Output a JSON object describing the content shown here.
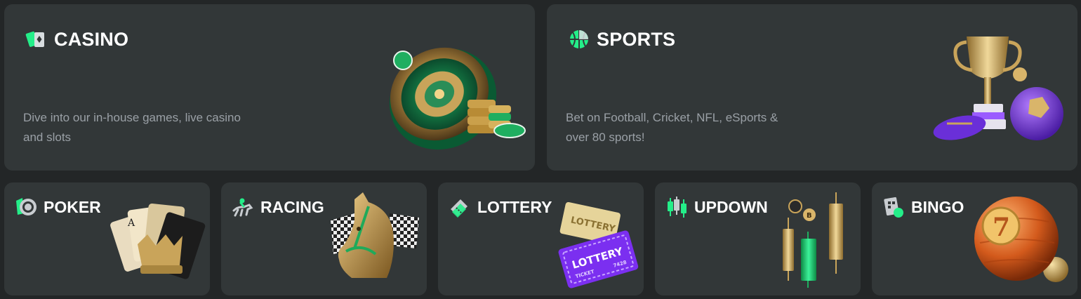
{
  "casino": {
    "title": "CASINO",
    "description": "Dive into our in-house games, live casino and slots",
    "icon": "cards-icon"
  },
  "sports": {
    "title": "SPORTS",
    "description": "Bet on Football, Cricket, NFL, eSports & over 80 sports!",
    "icon": "basketball-icon"
  },
  "tiles": [
    {
      "title": "POKER",
      "icon": "poker-chip-icon"
    },
    {
      "title": "RACING",
      "icon": "horse-rider-icon"
    },
    {
      "title": "LOTTERY",
      "icon": "ticket-icon"
    },
    {
      "title": "UPDOWN",
      "icon": "candlestick-icon"
    },
    {
      "title": "BINGO",
      "icon": "bingo-card-icon"
    }
  ],
  "art_labels": {
    "lottery_ticket": "LOTTERY",
    "ticket_word": "TICKET",
    "ticket_number": "7428",
    "bingo_ball": "7"
  },
  "colors": {
    "accent_green": "#24ee89",
    "card_bg": "#323738",
    "page_bg": "#232627",
    "muted_text": "#9aa0a6",
    "purple": "#7b2ff0",
    "gold": "#d9b56a"
  }
}
